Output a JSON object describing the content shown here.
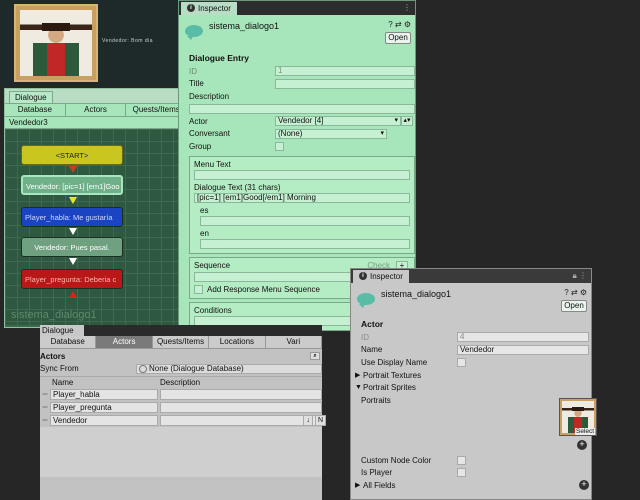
{
  "scene": {
    "caption": "Vendedor: Bom dia"
  },
  "dialogue_editor": {
    "tab": "Dialogue",
    "toolbar": [
      "Database",
      "Actors",
      "Quests/Items"
    ],
    "conversation": "Vendedor3",
    "nodes": [
      {
        "text": "<START>",
        "kind": "start"
      },
      {
        "text": "Vendedor: [pic=1] [em1]Goo",
        "kind": "npc"
      },
      {
        "text": "Player_habla: Me gustaría",
        "kind": "player"
      },
      {
        "text": "Vendedor: Pues pasal.",
        "kind": "npc"
      },
      {
        "text": "Player_pregunta: Deberia c",
        "kind": "player-red"
      }
    ],
    "watermark": "sistema_dialogo1"
  },
  "inspector_top": {
    "tab": "Inspector",
    "title": "sistema_dialogo1",
    "open_label": "Open",
    "section": "Dialogue Entry",
    "fields": {
      "id_label": "ID",
      "id_value": "1",
      "title_label": "Title",
      "title_value": "",
      "description_label": "Description",
      "description_value": "",
      "actor_label": "Actor",
      "actor_value": "Vendedor [4]",
      "conversant_label": "Conversant",
      "conversant_value": "(None)",
      "group_label": "Group"
    },
    "menu_text_label": "Menu Text",
    "menu_text_value": "",
    "dialogue_text_label": "Dialogue Text (31 chars)",
    "dialogue_text_value": "[pic=1] [em1]Good[/em1] Morning",
    "lang_es": "es",
    "lang_en": "en",
    "sequence_label": "Sequence",
    "check_label": "Check",
    "add_response_label": "Add Response Menu Sequence",
    "conditions_label": "Conditions"
  },
  "dialogue_window": {
    "tab": "Dialogue",
    "toolbar": [
      "Database",
      "Actors",
      "Quests/Items",
      "Locations",
      "Vari"
    ],
    "active_tab": "Actors",
    "actors_header": "Actors",
    "sync_from_label": "Sync From",
    "sync_from_value": "None (Dialogue Database)",
    "col_name": "Name",
    "col_description": "Description",
    "actors": [
      {
        "name": "Player_habla"
      },
      {
        "name": "Player_pregunta"
      },
      {
        "name": "Vendedor"
      }
    ],
    "row_button": "N"
  },
  "inspector_bottom": {
    "tab": "Inspector",
    "title": "sistema_dialogo1",
    "open_label": "Open",
    "section": "Actor",
    "id_label": "ID",
    "id_value": "4",
    "name_label": "Name",
    "name_value": "Vendedor",
    "use_display_name_label": "Use Display Name",
    "portrait_textures_label": "Portrait Textures",
    "portrait_sprites_label": "Portrait Sprites",
    "portraits_label": "Portraits",
    "select_label": "Select",
    "custom_node_color_label": "Custom Node Color",
    "is_player_label": "Is Player",
    "all_fields_label": "All Fields"
  },
  "icons": [
    "info-icon",
    "speech-bubble-icon",
    "help-icon",
    "settings-icon",
    "menu-icon",
    "lock-icon",
    "plus-icon",
    "search-icon",
    "drag-handle-icon",
    "dropdown-arrow-icon",
    "foldout-triangle-icon"
  ],
  "colors": {
    "inspector_green": "#a7e6bb",
    "node_start": "#c9c620",
    "node_player": "#1a44c2",
    "node_red": "#b81818",
    "node_npc": "#6fb088"
  }
}
